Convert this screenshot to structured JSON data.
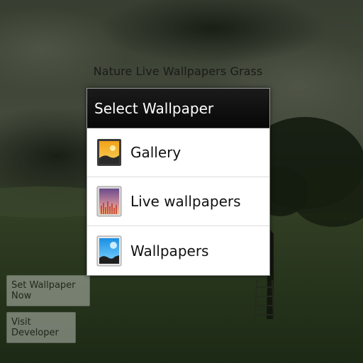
{
  "app": {
    "title": "Nature Live Wallpapers Grass",
    "set_button_label": "Set Wallpaper Now",
    "visit_button_label": "Visit Developer"
  },
  "dialog": {
    "title": "Select Wallpaper",
    "options": [
      {
        "label": "Gallery",
        "icon": "gallery-icon"
      },
      {
        "label": "Live wallpapers",
        "icon": "live-wallpapers-icon"
      },
      {
        "label": "Wallpapers",
        "icon": "wallpapers-icon"
      }
    ]
  },
  "colors": {
    "dialog_header_bg": "#0f0f0f",
    "dialog_body_bg": "#ffffff",
    "button_bg": "#b9beb6"
  }
}
